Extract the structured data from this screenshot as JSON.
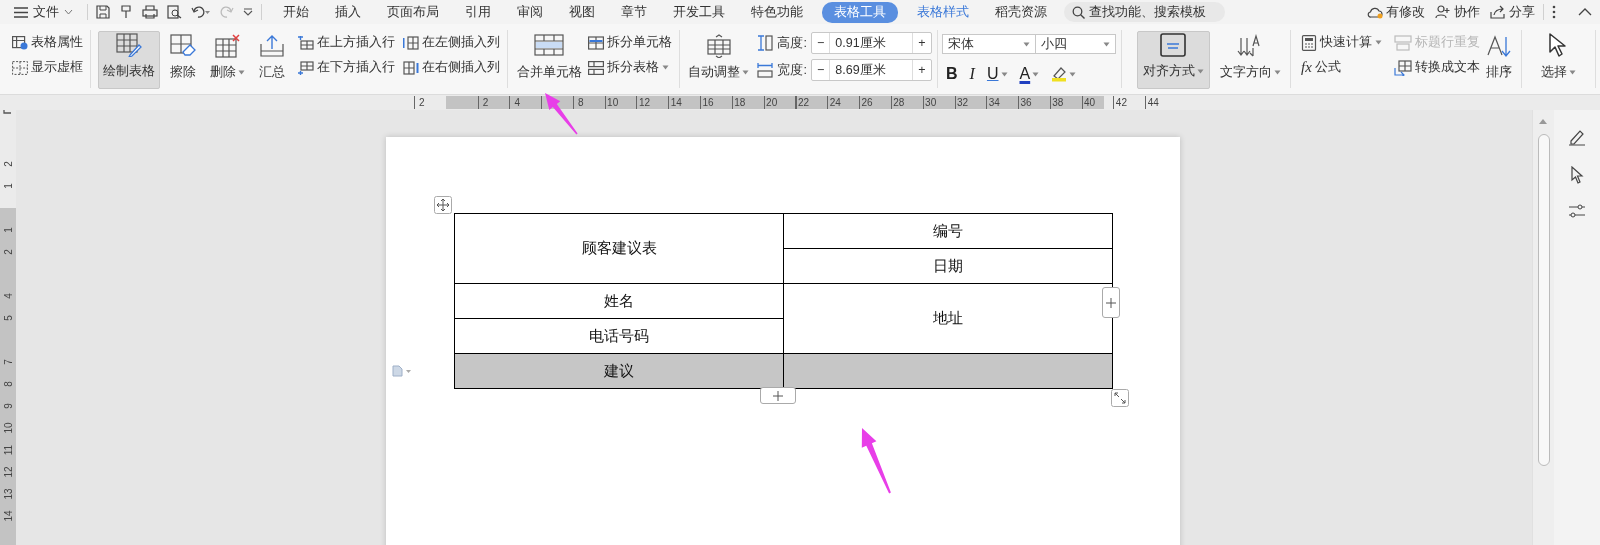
{
  "menu": {
    "file": "文件"
  },
  "tabs": [
    {
      "label": "开始",
      "kind": "normal",
      "selected": false
    },
    {
      "label": "插入",
      "kind": "normal",
      "selected": false
    },
    {
      "label": "页面布局",
      "kind": "normal",
      "selected": false
    },
    {
      "label": "引用",
      "kind": "normal",
      "selected": false
    },
    {
      "label": "审阅",
      "kind": "normal",
      "selected": false
    },
    {
      "label": "视图",
      "kind": "normal",
      "selected": false
    },
    {
      "label": "章节",
      "kind": "normal",
      "selected": false
    },
    {
      "label": "开发工具",
      "kind": "normal",
      "selected": false
    },
    {
      "label": "特色功能",
      "kind": "normal",
      "selected": false
    },
    {
      "label": "表格工具",
      "kind": "context",
      "selected": true
    },
    {
      "label": "表格样式",
      "kind": "context",
      "selected": false
    },
    {
      "label": "稻壳资源",
      "kind": "normal",
      "selected": false
    }
  ],
  "search": {
    "placeholder": "查找功能、搜索模板"
  },
  "header_actions": [
    {
      "label": "有修改",
      "kind": "cloud"
    },
    {
      "label": "协作",
      "kind": "person"
    },
    {
      "label": "分享",
      "kind": "share"
    }
  ],
  "ribbon": {
    "table_props": [
      {
        "label": "表格属性"
      },
      {
        "label": "显示虚框"
      }
    ],
    "draw_tools": [
      {
        "label": "绘制表格",
        "pressed": true,
        "dropdown": false
      },
      {
        "label": "擦除",
        "pressed": false,
        "dropdown": false
      },
      {
        "label": "删除",
        "pressed": false,
        "dropdown": true
      },
      {
        "label": "汇总",
        "pressed": false,
        "dropdown": false
      }
    ],
    "insert_rows": [
      {
        "label": "在上方插入行"
      },
      {
        "label": "在下方插入行"
      }
    ],
    "insert_columns": [
      {
        "label": "在左侧插入列"
      },
      {
        "label": "在右侧插入列"
      }
    ],
    "merge": {
      "label": "合并单元格"
    },
    "split": [
      {
        "label": "拆分单元格",
        "dropdown": false
      },
      {
        "label": "拆分表格",
        "dropdown": true
      }
    ],
    "autofit": {
      "label": "自动调整",
      "dropdown": true
    },
    "size_fields": [
      {
        "label": "高度:",
        "value": "0.91厘米",
        "minus": "−",
        "plus": "+"
      },
      {
        "label": "宽度:",
        "value": "8.69厘米",
        "minus": "−",
        "plus": "+"
      }
    ],
    "font": {
      "family": "宋体",
      "size": "小四"
    },
    "format_buttons": [
      {
        "kind": "bold",
        "label": "B",
        "dropdown": false
      },
      {
        "kind": "italic",
        "label": "I",
        "dropdown": false
      },
      {
        "kind": "underline",
        "label": "U",
        "dropdown": true
      },
      {
        "kind": "color",
        "label": "A",
        "dropdown": true
      },
      {
        "kind": "highlight",
        "dropdown": true
      }
    ],
    "align": {
      "label": "对齐方式",
      "pressed": true,
      "dropdown": true
    },
    "text_direction": {
      "label": "文字方向",
      "dropdown": true
    },
    "formula_tools": [
      {
        "label": "快速计算",
        "dropdown": true
      },
      {
        "symbol": "fx",
        "label": "公式",
        "dropdown": false
      }
    ],
    "header_tools": [
      {
        "label": "标题行重复",
        "disabled": true
      },
      {
        "label": "转换成文本",
        "disabled": false
      }
    ],
    "sort": {
      "label": "排序"
    },
    "select": {
      "label": "选择",
      "dropdown": true
    }
  },
  "ruler": {
    "horizontal": [
      "2",
      "2",
      "4",
      "8",
      "10",
      "12",
      "14",
      "16",
      "18",
      "20",
      "22",
      "24",
      "26",
      "28",
      "30",
      "32",
      "34",
      "36",
      "38",
      "40",
      "42",
      "44"
    ],
    "vertical": [
      "2",
      "1",
      "1",
      "2",
      "4",
      "5",
      "7",
      "8",
      "9",
      "10",
      "11",
      "12",
      "13",
      "14"
    ]
  },
  "table": {
    "columns": [
      {
        "cells": [
          {
            "text": "顾客建议表",
            "kind": "double",
            "shaded": false
          },
          {
            "text": "姓名",
            "kind": "single",
            "shaded": false
          },
          {
            "text": "电话号码",
            "kind": "single",
            "shaded": false
          },
          {
            "text": "建议",
            "kind": "single",
            "shaded": true
          }
        ]
      },
      {
        "cells": [
          {
            "text": "编号",
            "kind": "single",
            "shaded": false
          },
          {
            "text": "日期",
            "kind": "single",
            "shaded": false
          },
          {
            "text": "地址",
            "kind": "double",
            "shaded": false
          },
          {
            "kind": "single",
            "shaded": true
          }
        ]
      }
    ]
  }
}
